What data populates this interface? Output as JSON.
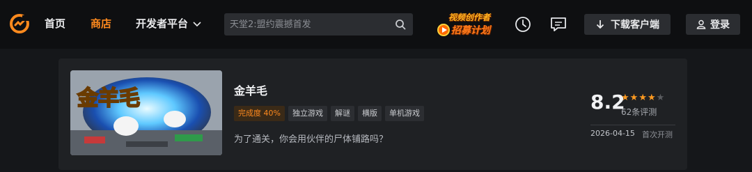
{
  "nav": {
    "home": "首页",
    "store": "商店",
    "developer": "开发者平台",
    "search_placeholder": "天堂2:盟约震撼首发",
    "promo_line1": "视频创作者",
    "promo_line2": "招募计划",
    "download": "下载客户端",
    "login": "登录",
    "accent_color": "#ff8a1e"
  },
  "game": {
    "title": "金羊毛",
    "cover_text": "金羊毛",
    "tags": [
      "完成度 40%",
      "独立游戏",
      "解谜",
      "横版",
      "单机游戏"
    ],
    "description": "为了通关，你会用伙伴的尸体铺路吗？",
    "score": "8.2",
    "stars_filled": 4,
    "stars_total": 5,
    "review_count": "62条评测",
    "date": "2026-04-15",
    "test_type": "首次开测"
  }
}
